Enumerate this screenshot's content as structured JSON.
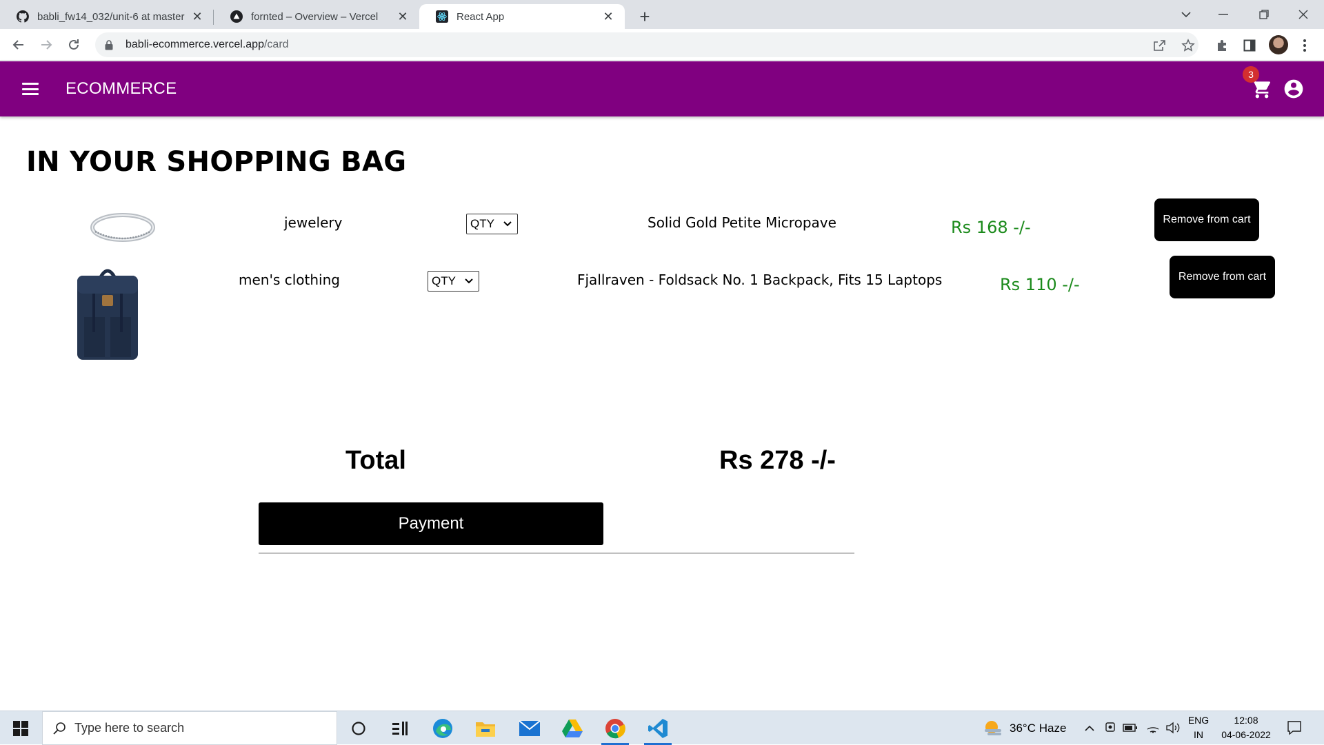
{
  "browser": {
    "tabs": [
      {
        "title": "babli_fw14_032/unit-6 at master",
        "icon": "github-icon",
        "active": false
      },
      {
        "title": "fornted – Overview – Vercel",
        "icon": "vercel-icon",
        "active": false
      },
      {
        "title": "React App",
        "icon": "react-icon",
        "active": true
      }
    ],
    "url_host": "babli-ecommerce.vercel.app",
    "url_path": "/card"
  },
  "appbar": {
    "brand": "ECOMMERCE",
    "cart_count": "3",
    "background": "#800080"
  },
  "page": {
    "title": "IN YOUR SHOPPING BAG",
    "items": [
      {
        "category": "jewelery",
        "qty_label": "QTY",
        "name": "Solid Gold Petite Micropave",
        "price": "Rs 168 -/-",
        "remove_label": "Remove from cart",
        "image": "ring-image"
      },
      {
        "category": "men's clothing",
        "qty_label": "QTY",
        "name": "Fjallraven - Foldsack No. 1 Backpack, Fits 15 Laptops",
        "price": "Rs 110 -/-",
        "remove_label": "Remove from cart",
        "image": "backpack-image"
      }
    ],
    "total_label": "Total",
    "total_value": "Rs 278 -/-",
    "payment_label": "Payment",
    "price_color": "#1b8a1b"
  },
  "taskbar": {
    "search_placeholder": "Type here to search",
    "weather": "36°C  Haze",
    "lang_top": "ENG",
    "lang_bottom": "IN",
    "time": "12:08",
    "date": "04-06-2022"
  }
}
